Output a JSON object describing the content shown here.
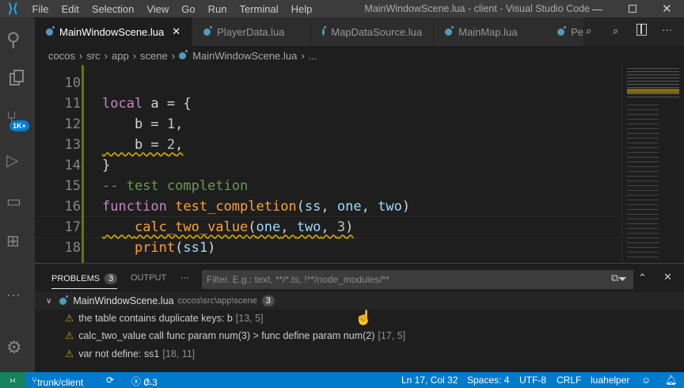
{
  "title": "MainWindowScene.lua - client - Visual Studio Code",
  "menu": [
    "File",
    "Edit",
    "Selection",
    "View",
    "Go",
    "Run",
    "Terminal",
    "Help"
  ],
  "activity": {
    "scm_badge": "1K+"
  },
  "tabs": [
    {
      "label": "MainWindowScene.lua",
      "active": true
    },
    {
      "label": "PlayerData.lua"
    },
    {
      "label": "MapDataSource.lua"
    },
    {
      "label": "MainMap.lua"
    },
    {
      "label": "Pe"
    }
  ],
  "breadcrumb": [
    "cocos",
    "src",
    "app",
    "scene",
    "MainWindowScene.lua",
    "..."
  ],
  "code": [
    {
      "n": "10",
      "t": ""
    },
    {
      "n": "11",
      "t": "local a = {"
    },
    {
      "n": "12",
      "t": "    b = 1,"
    },
    {
      "n": "13",
      "t": "    b = 2,"
    },
    {
      "n": "14",
      "t": "}"
    },
    {
      "n": "15",
      "t": "-- test completion"
    },
    {
      "n": "16",
      "t": "function test_completion(ss, one, two)"
    },
    {
      "n": "17",
      "t": "    calc_two_value(one, two, 3)"
    },
    {
      "n": "18",
      "t": "    print(ss1)"
    }
  ],
  "panel": {
    "problems_label": "PROBLEMS",
    "problems_count": "3",
    "output_label": "OUTPUT",
    "more": "···",
    "filter_placeholder": "Filter. E.g.: text, **/*.ts, !**/node_modules/**",
    "file": {
      "name": "MainWindowScene.lua",
      "path": "cocos\\src\\app\\scene",
      "count": "3"
    },
    "problems": [
      {
        "msg": "the table contains duplicate keys: b",
        "loc": "[13, 5]"
      },
      {
        "msg": "calc_two_value call func param num(3) > func define param num(2)",
        "loc": "[17, 5]"
      },
      {
        "msg": "var not define: ss1",
        "loc": "[18, 11]"
      }
    ]
  },
  "status": {
    "branch": "trunk/client",
    "errors": "0",
    "warnings": "3",
    "position": "Ln 17, Col 32",
    "spaces": "Spaces: 4",
    "encoding": "UTF-8",
    "eol": "CRLF",
    "language": "luahelper"
  },
  "colors": {
    "status": "#007acc",
    "accent": "#cca700"
  }
}
